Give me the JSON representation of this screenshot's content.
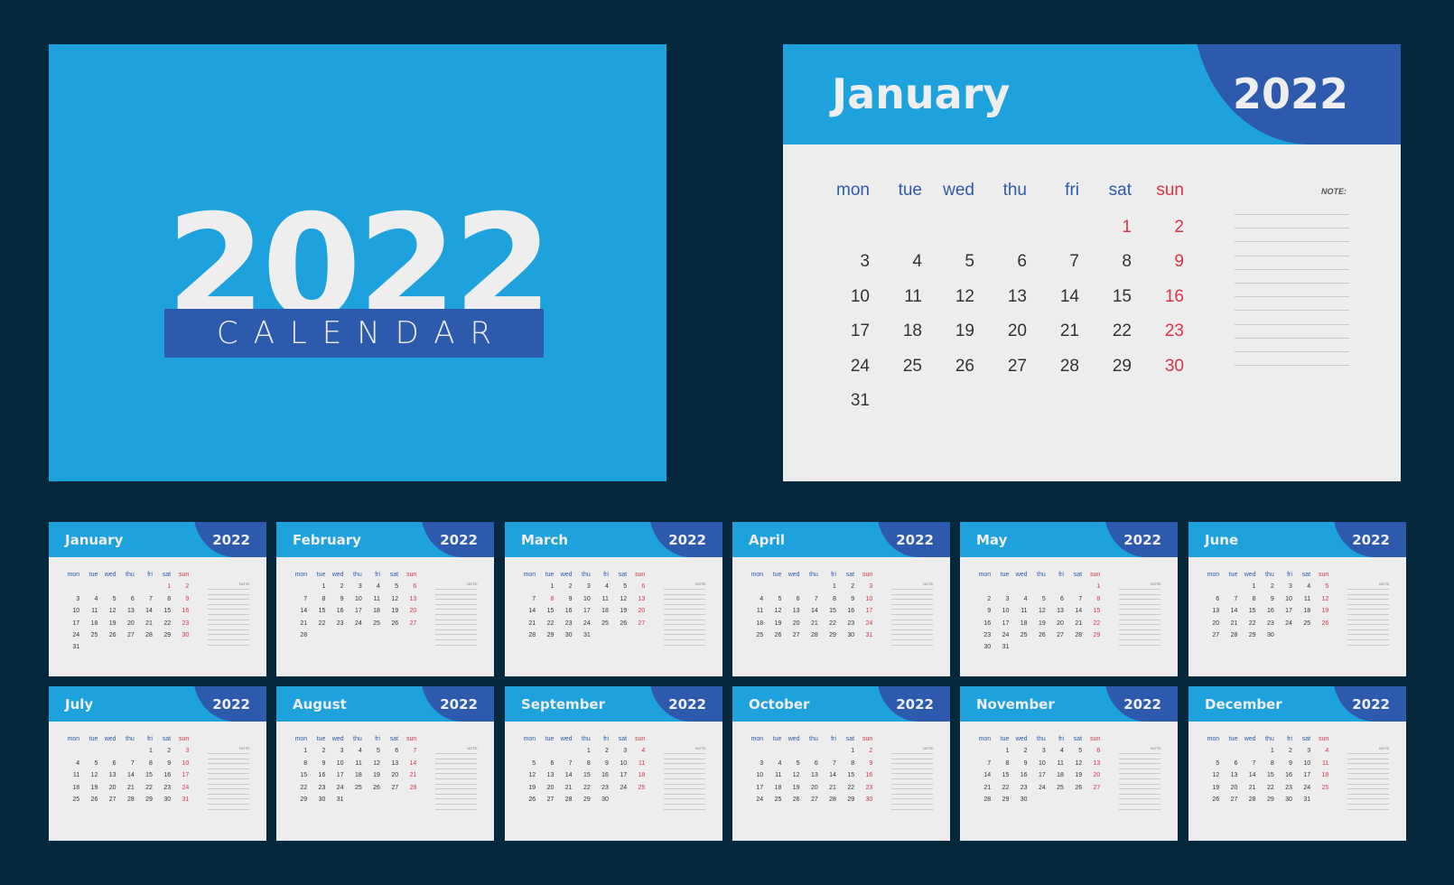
{
  "cover": {
    "year": "2022",
    "subtitle": "CALENDAR"
  },
  "colors": {
    "background": "#06283d",
    "primary_blue": "#1ea2dd",
    "dark_blue": "#2e5aad",
    "paper": "#ededed",
    "weekend_red": "#d9334a",
    "text_dark": "#333333"
  },
  "weekdays": [
    "mon",
    "tue",
    "wed",
    "thu",
    "fri",
    "sat",
    "sun"
  ],
  "note_label": "NOTE:",
  "featured": {
    "month": "January",
    "year": "2022",
    "offset": 5,
    "days": [
      "1",
      "2",
      "3",
      "4",
      "5",
      "6",
      "7",
      "8",
      "9",
      "10",
      "11",
      "12",
      "13",
      "14",
      "15",
      "16",
      "17",
      "18",
      "19",
      "20",
      "21",
      "22",
      "23",
      "24",
      "25",
      "26",
      "27",
      "28",
      "29",
      "30",
      "31"
    ],
    "red_days": [
      "1",
      "2",
      "9",
      "16",
      "23",
      "30"
    ]
  },
  "months": [
    {
      "name": "January",
      "year": "2022",
      "offset": 5,
      "days": [
        "1",
        "2",
        "3",
        "4",
        "5",
        "6",
        "7",
        "8",
        "9",
        "10",
        "11",
        "12",
        "13",
        "14",
        "15",
        "16",
        "17",
        "18",
        "19",
        "20",
        "21",
        "22",
        "23",
        "24",
        "25",
        "26",
        "27",
        "28",
        "29",
        "30",
        "31"
      ],
      "red_days": [
        "1",
        "2",
        "9",
        "16",
        "23",
        "30"
      ]
    },
    {
      "name": "February",
      "year": "2022",
      "offset": 1,
      "days": [
        "1",
        "2",
        "3",
        "4",
        "5",
        "6",
        "7",
        "8",
        "9",
        "10",
        "11",
        "12",
        "13",
        "14",
        "15",
        "16",
        "17",
        "18",
        "19",
        "20",
        "21",
        "22",
        "23",
        "24",
        "25",
        "26",
        "27",
        "28"
      ],
      "red_days": [
        "6",
        "13",
        "20",
        "27"
      ]
    },
    {
      "name": "March",
      "year": "2022",
      "offset": 1,
      "days": [
        "1",
        "2",
        "3",
        "4",
        "5",
        "6",
        "7",
        "8",
        "9",
        "10",
        "11",
        "12",
        "13",
        "14",
        "15",
        "16",
        "17",
        "18",
        "19",
        "20",
        "21",
        "22",
        "23",
        "24",
        "25",
        "26",
        "27",
        "28",
        "29",
        "30",
        "31"
      ],
      "red_days": [
        "6",
        "8",
        "13",
        "20",
        "27"
      ]
    },
    {
      "name": "April",
      "year": "2022",
      "offset": 4,
      "days": [
        "1",
        "2",
        "3",
        "4",
        "5",
        "6",
        "7",
        "8",
        "9",
        "10",
        "11",
        "12",
        "13",
        "14",
        "15",
        "16",
        "17",
        "18",
        "19",
        "20",
        "21",
        "22",
        "23",
        "24",
        "25",
        "26",
        "27",
        "28",
        "29",
        "30",
        "31"
      ],
      "red_days": [
        "3",
        "10",
        "17",
        "24",
        "31"
      ]
    },
    {
      "name": "May",
      "year": "2022",
      "offset": 6,
      "days": [
        "1",
        "2",
        "3",
        "4",
        "5",
        "6",
        "7",
        "8",
        "9",
        "10",
        "11",
        "12",
        "13",
        "14",
        "15",
        "16",
        "17",
        "18",
        "19",
        "20",
        "21",
        "22",
        "23",
        "24",
        "25",
        "26",
        "27",
        "28",
        "29",
        "30",
        "31"
      ],
      "red_days": [
        "1",
        "8",
        "15",
        "22",
        "29"
      ]
    },
    {
      "name": "June",
      "year": "2022",
      "offset": 2,
      "days": [
        "1",
        "2",
        "3",
        "4",
        "5",
        "6",
        "7",
        "8",
        "9",
        "10",
        "11",
        "12",
        "13",
        "14",
        "15",
        "16",
        "17",
        "18",
        "19",
        "20",
        "21",
        "22",
        "23",
        "24",
        "25",
        "26",
        "27",
        "28",
        "29",
        "30"
      ],
      "red_days": [
        "5",
        "12",
        "19",
        "26"
      ]
    },
    {
      "name": "July",
      "year": "2022",
      "offset": 4,
      "days": [
        "1",
        "2",
        "3",
        "4",
        "5",
        "6",
        "7",
        "8",
        "9",
        "10",
        "11",
        "12",
        "13",
        "14",
        "15",
        "16",
        "17",
        "18",
        "19",
        "20",
        "21",
        "22",
        "23",
        "24",
        "25",
        "26",
        "27",
        "28",
        "29",
        "30",
        "31"
      ],
      "red_days": [
        "3",
        "10",
        "17",
        "24",
        "31"
      ]
    },
    {
      "name": "August",
      "year": "2022",
      "offset": 0,
      "days": [
        "1",
        "2",
        "3",
        "4",
        "5",
        "6",
        "7",
        "8",
        "9",
        "10",
        "11",
        "12",
        "13",
        "14",
        "15",
        "16",
        "17",
        "18",
        "19",
        "20",
        "21",
        "22",
        "23",
        "24",
        "25",
        "26",
        "27",
        "28",
        "29",
        "30",
        "31"
      ],
      "red_days": [
        "7",
        "14",
        "21",
        "28"
      ]
    },
    {
      "name": "September",
      "year": "2022",
      "offset": 3,
      "days": [
        "1",
        "2",
        "3",
        "4",
        "5",
        "6",
        "7",
        "8",
        "9",
        "10",
        "11",
        "12",
        "13",
        "14",
        "15",
        "16",
        "17",
        "18",
        "19",
        "20",
        "21",
        "22",
        "23",
        "24",
        "25",
        "26",
        "27",
        "28",
        "29",
        "30"
      ],
      "red_days": [
        "4",
        "11",
        "18",
        "25"
      ]
    },
    {
      "name": "October",
      "year": "2022",
      "offset": 5,
      "days": [
        "1",
        "2",
        "3",
        "4",
        "5",
        "6",
        "7",
        "8",
        "9",
        "10",
        "11",
        "12",
        "13",
        "14",
        "15",
        "16",
        "17",
        "18",
        "19",
        "20",
        "21",
        "22",
        "23",
        "24",
        "25",
        "26",
        "27",
        "28",
        "29",
        "30"
      ],
      "red_days": [
        "2",
        "9",
        "16",
        "23",
        "30"
      ]
    },
    {
      "name": "November",
      "year": "2022",
      "offset": 1,
      "days": [
        "1",
        "2",
        "3",
        "4",
        "5",
        "6",
        "7",
        "8",
        "9",
        "10",
        "11",
        "12",
        "13",
        "14",
        "15",
        "16",
        "17",
        "18",
        "19",
        "20",
        "21",
        "22",
        "23",
        "24",
        "25",
        "26",
        "27",
        "28",
        "29",
        "30"
      ],
      "red_days": [
        "6",
        "13",
        "20",
        "27"
      ]
    },
    {
      "name": "December",
      "year": "2022",
      "offset": 3,
      "days": [
        "1",
        "2",
        "3",
        "4",
        "5",
        "6",
        "7",
        "8",
        "9",
        "10",
        "11",
        "12",
        "13",
        "14",
        "15",
        "16",
        "17",
        "18",
        "19",
        "20",
        "21",
        "22",
        "23",
        "24",
        "25",
        "26",
        "27",
        "28",
        "29",
        "30",
        "31"
      ],
      "red_days": [
        "4",
        "11",
        "18",
        "25"
      ]
    }
  ]
}
